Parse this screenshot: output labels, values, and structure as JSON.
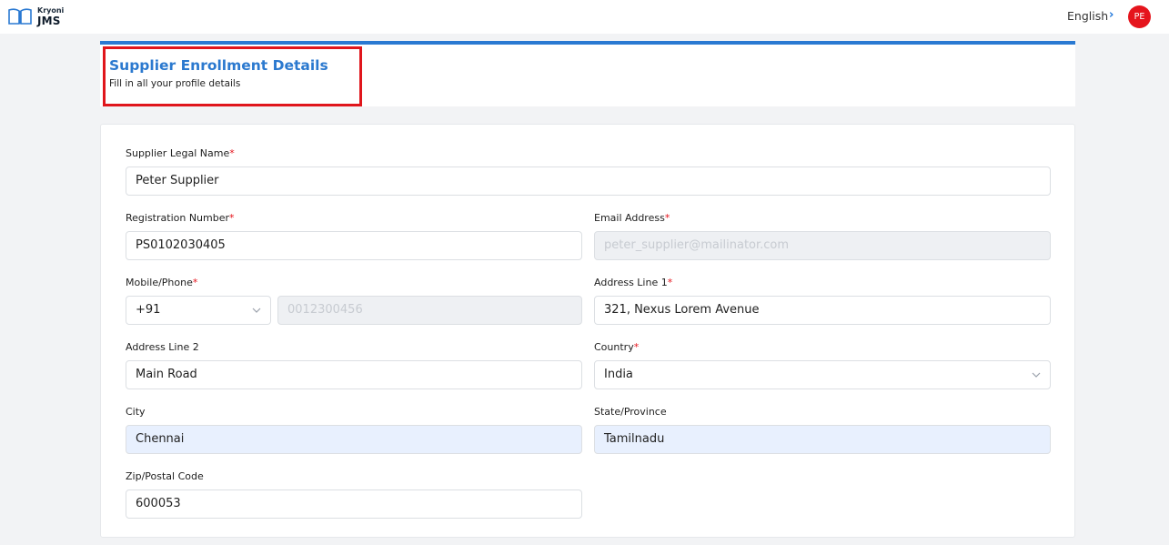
{
  "header": {
    "brand_top": "Kryoni",
    "brand_main": "JMS",
    "language": "English",
    "avatar_initials": "PE"
  },
  "page": {
    "title": "Supplier Enrollment Details",
    "subtitle": "Fill in all your profile details"
  },
  "form": {
    "supplier_legal_name": {
      "label": "Supplier Legal Name",
      "value": "Peter Supplier",
      "required": "*"
    },
    "registration_number": {
      "label": "Registration Number",
      "value": "PS0102030405",
      "required": "*"
    },
    "email_address": {
      "label": "Email Address",
      "value": "peter_supplier@mailinator.com",
      "required": "*"
    },
    "mobile_phone": {
      "label": "Mobile/Phone",
      "code": "+91",
      "value": "0012300456",
      "required": "*"
    },
    "address_line_1": {
      "label": "Address Line 1",
      "value": "321,  Nexus Lorem Avenue",
      "required": "*"
    },
    "address_line_2": {
      "label": "Address Line 2",
      "value": "Main Road"
    },
    "country": {
      "label": "Country",
      "value": "India",
      "required": "*"
    },
    "city": {
      "label": "City",
      "value": "Chennai"
    },
    "state_province": {
      "label": "State/Province",
      "value": "Tamilnadu"
    },
    "zip_postal_code": {
      "label": "Zip/Postal Code",
      "value": "600053"
    }
  },
  "colors": {
    "accent": "#2a79d2",
    "required": "#e5141c",
    "highlight_box": "#e0161c",
    "autofill_bg": "#e8f0fe"
  }
}
